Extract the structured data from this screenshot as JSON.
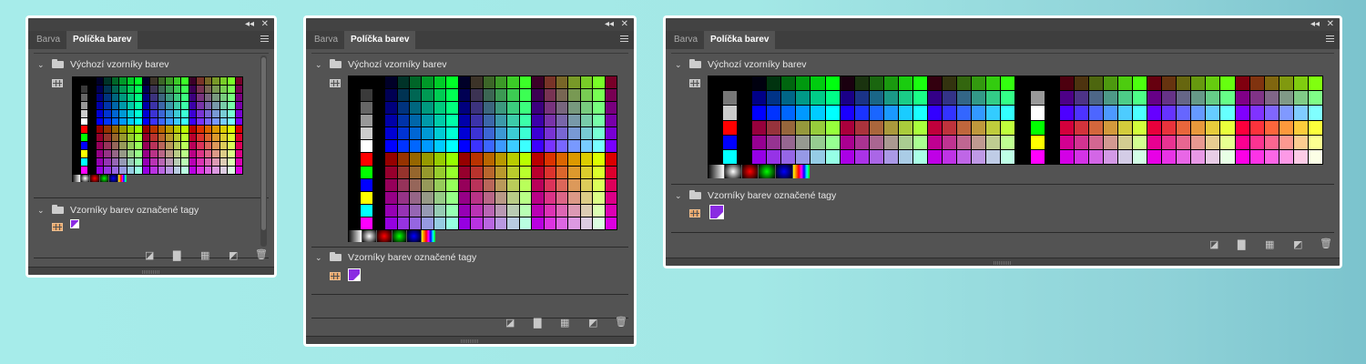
{
  "panels": [
    {
      "tabs": [
        "Barva",
        "Políčka barev"
      ],
      "active_tab": 1,
      "groups": [
        "Výchozí vzorníky barev",
        "Vzorníky barev označené tagy"
      ]
    },
    {
      "tabs": [
        "Barva",
        "Políčka barev"
      ],
      "active_tab": 1,
      "groups": [
        "Výchozí vzorníky barev",
        "Vzorníky barev označené tagy"
      ]
    },
    {
      "tabs": [
        "Barva",
        "Políčka barev"
      ],
      "active_tab": 1,
      "groups": [
        "Výchozí vzorníky barev",
        "Vzorníky barev označené tagy"
      ]
    }
  ],
  "controls": {
    "collapse": "◂◂",
    "close": "✕",
    "expand": "⌄"
  },
  "icons": [
    "collapse-icon",
    "close-icon",
    "panel-menu-icon",
    "folder-icon",
    "grid-view-icon",
    "new-group-icon",
    "new-swatch-icon",
    "delete-icon",
    "clear-icon"
  ],
  "colors": {
    "panel_bg": "#535353",
    "tab_bar": "#3e3e3e",
    "active_tab": "#535353",
    "tag_swatch": "#8a2be2",
    "selected_view": "#e3a46a"
  }
}
